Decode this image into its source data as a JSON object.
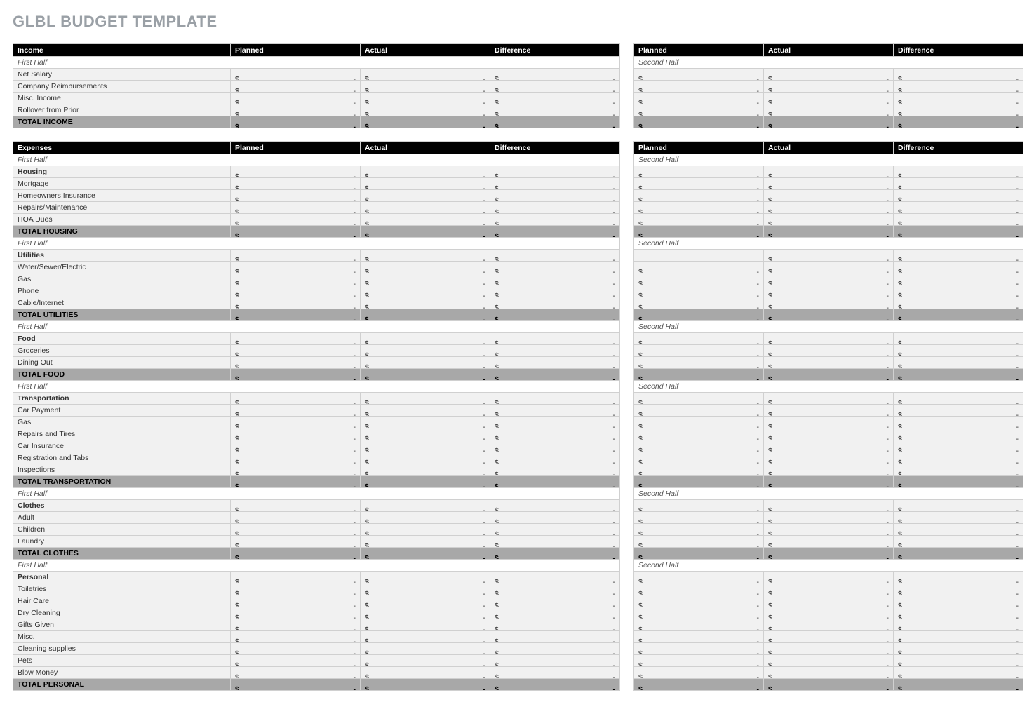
{
  "title": "GLBL BUDGET TEMPLATE",
  "currency": "$",
  "empty": "-",
  "halfLabels": {
    "first": "First Half",
    "second": "Second Half"
  },
  "columns": {
    "planned": "Planned",
    "actual": "Actual",
    "difference": "Difference"
  },
  "blocks": [
    {
      "key": "income",
      "headerLabel": "Income",
      "sections": [
        {
          "rows": [
            {
              "label": "Net Salary"
            },
            {
              "label": "Company Reimbursements"
            },
            {
              "label": "Misc. Income"
            },
            {
              "label": "Rollover from Prior"
            }
          ],
          "total": "TOTAL INCOME"
        }
      ]
    },
    {
      "key": "expenses",
      "headerLabel": "Expenses",
      "sections": [
        {
          "rows": [
            {
              "label": "Housing",
              "bold": true
            },
            {
              "label": "Mortgage"
            },
            {
              "label": "Homeowners Insurance"
            },
            {
              "label": "Repairs/Maintenance"
            },
            {
              "label": "HOA Dues"
            }
          ],
          "total": "TOTAL HOUSING"
        },
        {
          "rows": [
            {
              "label": "Utilities",
              "bold": true,
              "secondPlannedBlank": true
            },
            {
              "label": "Water/Sewer/Electric"
            },
            {
              "label": "Gas"
            },
            {
              "label": "Phone"
            },
            {
              "label": "Cable/Internet"
            }
          ],
          "total": "TOTAL UTILITIES"
        },
        {
          "rows": [
            {
              "label": "Food",
              "bold": true
            },
            {
              "label": "Groceries"
            },
            {
              "label": "Dining Out"
            }
          ],
          "total": "TOTAL FOOD"
        },
        {
          "rows": [
            {
              "label": "Transportation",
              "bold": true
            },
            {
              "label": "Car Payment"
            },
            {
              "label": "Gas"
            },
            {
              "label": "Repairs and Tires"
            },
            {
              "label": "Car Insurance"
            },
            {
              "label": "Registration and Tabs"
            },
            {
              "label": "Inspections"
            }
          ],
          "total": "TOTAL TRANSPORTATION"
        },
        {
          "rows": [
            {
              "label": "Clothes",
              "bold": true
            },
            {
              "label": "Adult"
            },
            {
              "label": "Children"
            },
            {
              "label": "Laundry"
            }
          ],
          "total": "TOTAL CLOTHES"
        },
        {
          "rows": [
            {
              "label": "Personal",
              "bold": true
            },
            {
              "label": "Toiletries"
            },
            {
              "label": "Hair Care"
            },
            {
              "label": "Dry Cleaning"
            },
            {
              "label": "Gifts Given"
            },
            {
              "label": "Misc."
            },
            {
              "label": "Cleaning supplies"
            },
            {
              "label": "Pets"
            },
            {
              "label": "Blow Money"
            }
          ],
          "total": "TOTAL PERSONAL"
        }
      ]
    }
  ]
}
